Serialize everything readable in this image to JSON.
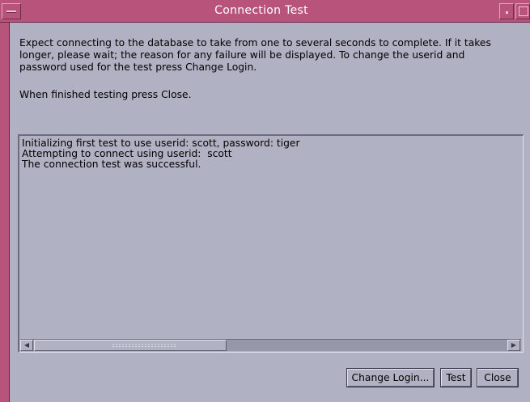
{
  "window": {
    "title": "Connection Test"
  },
  "content": {
    "description": "Expect connecting to the database to take from one to several seconds to complete. If it takes\nlonger, please wait; the reason for any failure will be displayed. To change the userid and\npassword used for the test press Change Login.",
    "finish_note": "When finished testing press Close."
  },
  "log": {
    "lines": [
      "Initializing first test to use userid: scott, password: tiger",
      "Attempting to connect using userid:  scott",
      "The connection test was successful."
    ]
  },
  "buttons": {
    "change_login": "Change Login...",
    "test": "Test",
    "close": "Close"
  },
  "icons": {
    "window_menu": "window-menu-icon",
    "minimize": "minimize-icon",
    "maximize": "maximize-icon",
    "scroll_left": "arrow-left-icon",
    "scroll_right": "arrow-right-icon"
  },
  "colors": {
    "titlebar": "#b8547c",
    "background": "#b0b2c4"
  }
}
